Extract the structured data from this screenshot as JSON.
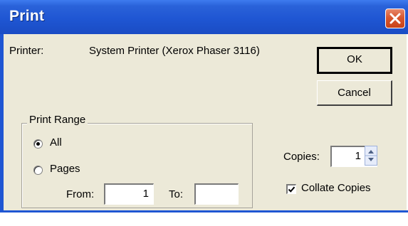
{
  "dialog": {
    "title": "Print",
    "printer_label": "Printer:",
    "printer_name": "System Printer (Xerox Phaser 3116)",
    "ok_label": "OK",
    "cancel_label": "Cancel",
    "print_range": {
      "legend": "Print Range",
      "all_label": "All",
      "pages_label": "Pages",
      "selected": "All",
      "from_label": "From:",
      "from_value": "1",
      "to_label": "To:",
      "to_value": ""
    },
    "copies_label": "Copies:",
    "copies_value": "1",
    "collate_label": "Collate Copies",
    "collate_checked": true
  },
  "colors": {
    "titlebar": "#1f56d3",
    "close_button": "#d8572f",
    "dialog_face": "#ece9d8"
  },
  "icons": {
    "close": "close-x-icon",
    "spin": "spinner-arrows-icon",
    "check": "checkmark-icon"
  }
}
